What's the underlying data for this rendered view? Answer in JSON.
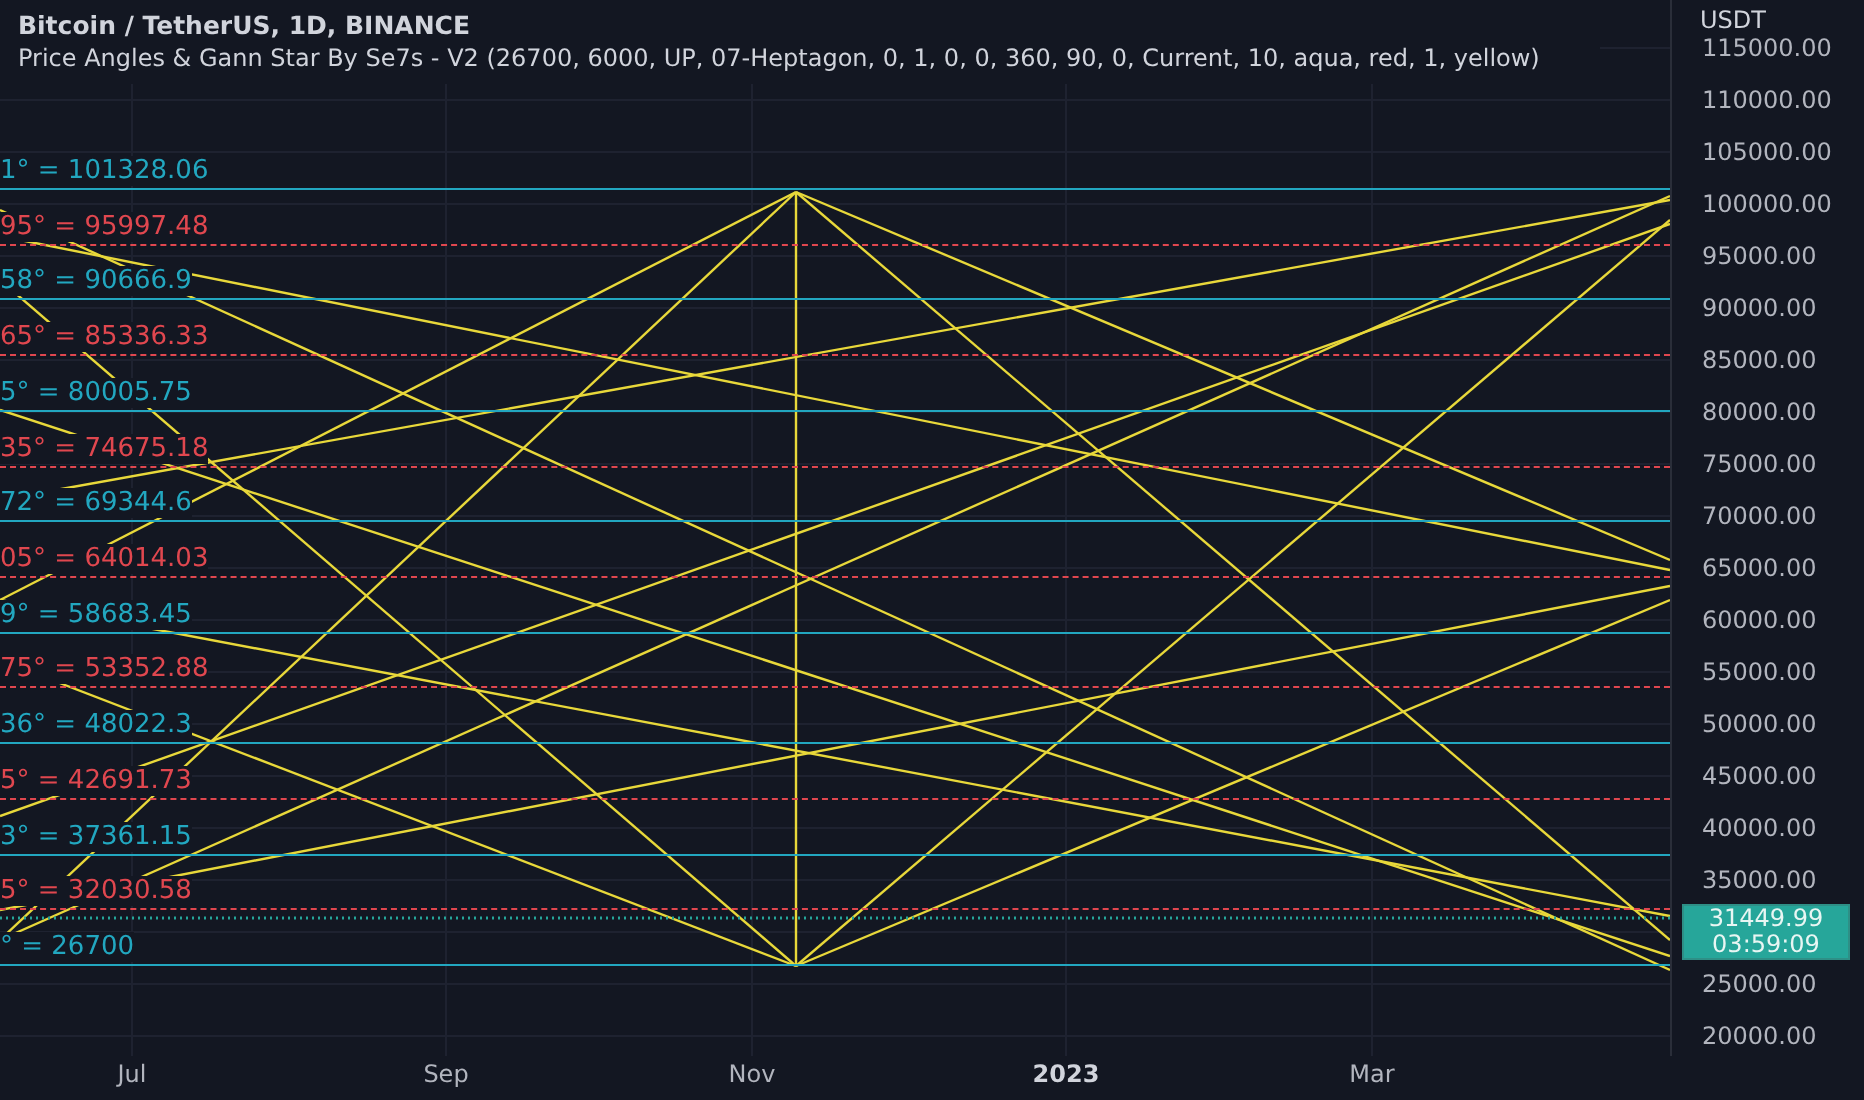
{
  "header": {
    "symbol": "Bitcoin / TetherUS, 1D, BINANCE",
    "indicator": "Price Angles & Gann Star By Se7s - V2 (26700, 6000, UP, 07-Heptagon, 0, 1, 0, 0, 360, 90, 0, Current, 10, aqua, red, 1, yellow)"
  },
  "levels": [
    {
      "label": "1° = 101328.06",
      "kind": "aqua"
    },
    {
      "label": "95° = 95997.48",
      "kind": "red"
    },
    {
      "label": "58° = 90666.9",
      "kind": "aqua"
    },
    {
      "label": "65° = 85336.33",
      "kind": "red"
    },
    {
      "label": "5° = 80005.75",
      "kind": "aqua"
    },
    {
      "label": "35° = 74675.18",
      "kind": "red"
    },
    {
      "label": "72° = 69344.6",
      "kind": "aqua"
    },
    {
      "label": "05° = 64014.03",
      "kind": "red"
    },
    {
      "label": "9° = 58683.45",
      "kind": "aqua"
    },
    {
      "label": "75° = 53352.88",
      "kind": "red"
    },
    {
      "label": "36° = 48022.3",
      "kind": "aqua"
    },
    {
      "label": "5° = 42691.73",
      "kind": "red"
    },
    {
      "label": "3° = 37361.15",
      "kind": "aqua"
    },
    {
      "label": "5° = 32030.58",
      "kind": "red"
    },
    {
      "label": "° = 26700",
      "kind": "aqua"
    }
  ],
  "price_axis": {
    "currency": "USDT",
    "ticks": [
      "115000.00",
      "110000.00",
      "105000.00",
      "100000.00",
      "95000.00",
      "90000.00",
      "85000.00",
      "80000.00",
      "75000.00",
      "70000.00",
      "65000.00",
      "60000.00",
      "55000.00",
      "50000.00",
      "45000.00",
      "40000.00",
      "35000.00",
      "25000.00",
      "20000.00"
    ],
    "last_price": {
      "price": "31449.99",
      "countdown": "03:59:09"
    }
  },
  "time_axis": [
    {
      "label": "Jul",
      "kind": "month"
    },
    {
      "label": "Sep",
      "kind": "month"
    },
    {
      "label": "Nov",
      "kind": "month"
    },
    {
      "label": "2023",
      "kind": "year"
    },
    {
      "label": "Mar",
      "kind": "month"
    }
  ]
}
